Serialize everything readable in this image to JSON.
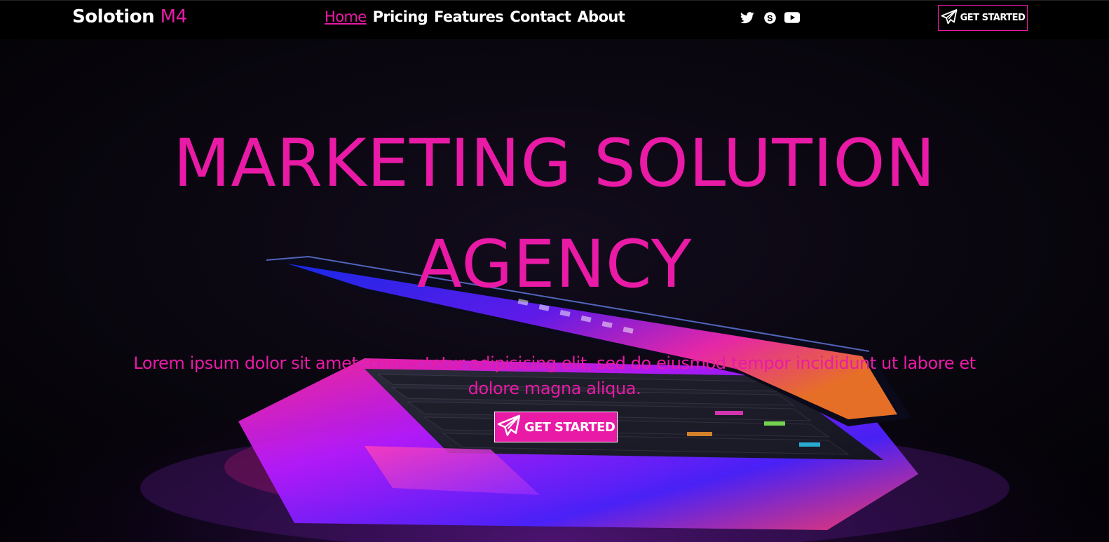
{
  "header": {
    "brand_name": "Solotion",
    "brand_accent": "M4",
    "nav": [
      {
        "label": "Home",
        "active": true
      },
      {
        "label": "Pricing",
        "active": false
      },
      {
        "label": "Features",
        "active": false
      },
      {
        "label": "Contact",
        "active": false
      },
      {
        "label": "About",
        "active": false
      }
    ],
    "social_icons": [
      "twitter-icon",
      "skype-icon",
      "youtube-icon"
    ],
    "cta_label": "GET STARTED",
    "cta_icon": "paper-plane-icon"
  },
  "hero": {
    "title_line1": "MARKETING SOLUTION",
    "title_line2": "AGENCY",
    "subtitle": "Lorem ipsum dolor sit amet, consectetur adipisicing elit, sed do eiusmod tempor incididunt ut labore et dolore magna aliqua.",
    "cta_label": "GET STARTED",
    "cta_icon": "paper-plane-icon",
    "background": "laptop-photo"
  },
  "colors": {
    "accent": "#e91aa6",
    "navbar_bg": "#000000",
    "text_light": "#ffffff"
  }
}
